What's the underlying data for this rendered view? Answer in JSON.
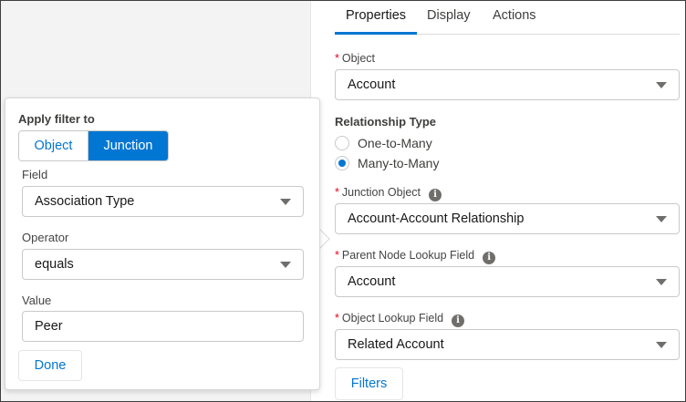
{
  "tabs": [
    {
      "label": "Properties",
      "active": true
    },
    {
      "label": "Display",
      "active": false
    },
    {
      "label": "Actions",
      "active": false
    }
  ],
  "properties": {
    "object": {
      "required": "*",
      "label": "Object",
      "value": "Account"
    },
    "relationship_type": {
      "label": "Relationship Type",
      "options": [
        {
          "label": "One-to-Many",
          "checked": false
        },
        {
          "label": "Many-to-Many",
          "checked": true
        }
      ]
    },
    "junction_object": {
      "required": "*",
      "label": "Junction Object",
      "value": "Account-Account Relationship",
      "info_icon": "i"
    },
    "parent_node_lookup": {
      "required": "*",
      "label": "Parent Node Lookup Field",
      "value": "Account",
      "info_icon": "i"
    },
    "object_lookup": {
      "required": "*",
      "label": "Object Lookup Field",
      "value": "Related Account",
      "info_icon": "i"
    },
    "filters_button": "Filters"
  },
  "filter_popover": {
    "title": "Apply filter to",
    "segments": [
      {
        "label": "Object",
        "selected": false
      },
      {
        "label": "Junction",
        "selected": true
      }
    ],
    "field": {
      "label": "Field",
      "value": "Association Type"
    },
    "operator": {
      "label": "Operator",
      "value": "equals"
    },
    "value": {
      "label": "Value",
      "value": "Peer"
    },
    "done_button": "Done"
  },
  "colors": {
    "brand": "#0176d3",
    "required": "#ea001e",
    "border": "#c9c9c9",
    "background": "#f3f3f3"
  }
}
